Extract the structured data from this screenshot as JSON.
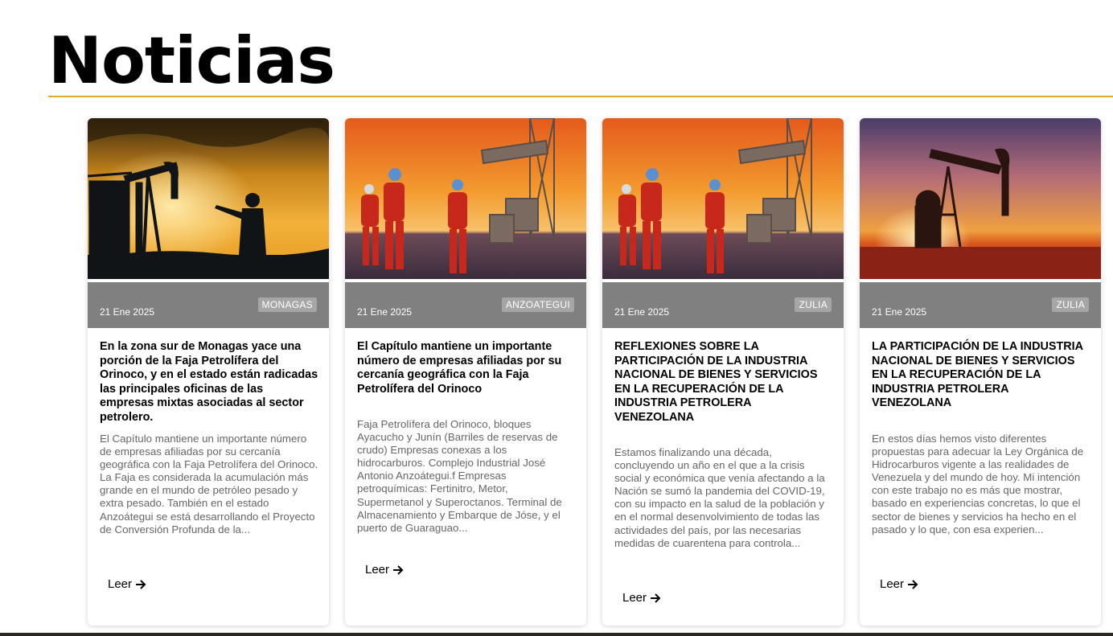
{
  "page": {
    "title": "Noticias"
  },
  "colors": {
    "accent_rule": "#e5a81f",
    "meta_bar": "#808080",
    "tag_bg": "#a6a6a6"
  },
  "cards": [
    {
      "date": "21 Ene 2025",
      "tag": "MONAGAS",
      "title": "En la zona sur de Monagas yace una porción de la Faja Petrolífera del Orinoco, y en el estado están radicadas las principales oficinas de las empresas mixtas asociadas al sector petrolero.",
      "excerpt": "El Capítulo mantiene un importante número de empresas afiliadas por su cercanía geográfica con la Faja Petrolífera del Orinoco. La Faja es considerada la acumulación más grande en el mundo de petróleo pesado y extra pesado. También en el estado Anzoátegui se está desarrollando el Proyecto de Conversión Profunda de la...",
      "read_label": "Leer",
      "image_icon": "oil-worker-silhouette-image"
    },
    {
      "date": "21 Ene 2025",
      "tag": "ANZOATEGUI",
      "title": "El Capítulo mantiene un importante número de empresas afiliadas por su cercanía geográfica con la Faja Petrolífera del Orinoco",
      "excerpt": "Faja Petrolífera del Orinoco, bloques Ayacucho y Junín (Barriles de reservas de crudo) Empresas conexas a los hidrocarburos. Complejo Industrial José Antonio Anzoátegui.f Empresas petroquímicas: Fertinitro, Metor, Supermetanol y Superoctanos. Terminal de Almacenamiento y Embarque de Jóse, y el puerto de Guaraguao...",
      "read_label": "Leer",
      "image_icon": "oil-workers-image"
    },
    {
      "date": "21 Ene 2025",
      "tag": "ZULIA",
      "title": "REFLEXIONES SOBRE LA PARTICIPACIÓN DE LA INDUSTRIA NACIONAL DE BIENES Y SERVICIOS EN LA RECUPERACIÓN DE LA INDUSTRIA PETROLERA VENEZOLANA",
      "excerpt": "Estamos finalizando una década, concluyendo un año en el que a la crisis social y económica que venía afectando a la Nación se sumó la pandemia del COVID-19, con su impacto en la salud de la población y en el normal desenvolvimiento de todas las actividades del país, por las necesarias medidas de cuarentena para controla...",
      "read_label": "Leer",
      "image_icon": "oil-workers-image"
    },
    {
      "date": "21 Ene 2025",
      "tag": "ZULIA",
      "title": "LA PARTICIPACIÓN DE LA INDUSTRIA NACIONAL DE BIENES Y SERVICIOS EN LA RECUPERACIÓN DE LA INDUSTRIA PETROLERA VENEZOLANA",
      "excerpt": "En estos días hemos visto diferentes propuestas para adecuar la Ley Orgánica de Hidrocarburos vigente a las realidades de Venezuela y del mundo de hoy. Mi intención con este trabajo no es más que mostrar, basado en experiencias concretas, lo que el sector de bienes y servicios ha hecho en el pasado y lo que, con esa experien...",
      "read_label": "Leer",
      "image_icon": "pumpjack-sunset-image"
    }
  ]
}
